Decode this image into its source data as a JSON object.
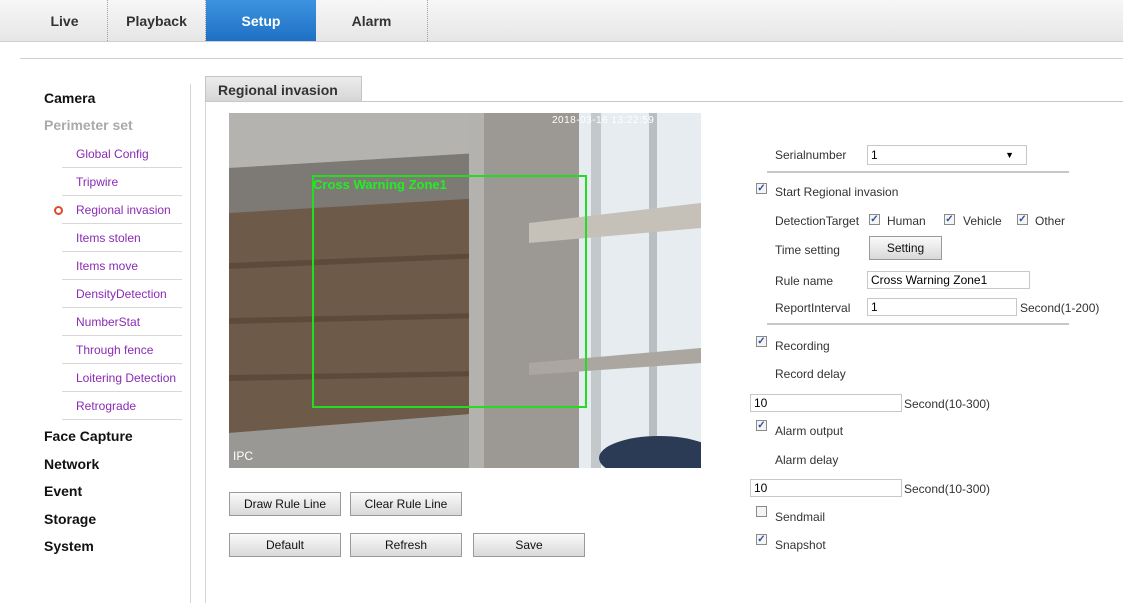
{
  "nav": {
    "tabs": [
      {
        "label": "Live"
      },
      {
        "label": "Playback"
      },
      {
        "label": "Setup"
      },
      {
        "label": "Alarm"
      }
    ]
  },
  "sidebar": {
    "camera": "Camera",
    "perimeter": "Perimeter set",
    "items": [
      {
        "label": "Global Config"
      },
      {
        "label": "Tripwire"
      },
      {
        "label": "Regional invasion"
      },
      {
        "label": "Items stolen"
      },
      {
        "label": "Items move"
      },
      {
        "label": "DensityDetection"
      },
      {
        "label": "NumberStat"
      },
      {
        "label": "Through fence"
      },
      {
        "label": "Loitering Detection"
      },
      {
        "label": "Retrograde"
      }
    ],
    "face_capture": "Face Capture",
    "network": "Network",
    "event": "Event",
    "storage": "Storage",
    "system": "System"
  },
  "section": {
    "title": "Regional invasion"
  },
  "video": {
    "zone_label": "Cross Warning Zone1",
    "osd_ipc": "IPC",
    "osd_time": "2018-03-16 13:22:59"
  },
  "buttons": {
    "draw": "Draw Rule Line",
    "clear": "Clear Rule Line",
    "default": "Default",
    "refresh": "Refresh",
    "save": "Save",
    "setting": "Setting"
  },
  "form": {
    "serial_label": "Serialnumber",
    "serial_value": "1",
    "start_label": "Start Regional invasion",
    "detection_label": "DetectionTarget",
    "human": "Human",
    "vehicle": "Vehicle",
    "other": "Other",
    "time_label": "Time setting",
    "rule_label": "Rule name",
    "rule_value": "Cross Warning Zone1",
    "report_label": "ReportInterval",
    "report_value": "1",
    "report_unit": "Second(1-200)",
    "recording": "Recording",
    "record_delay": "Record delay",
    "record_delay_value": "10",
    "record_unit": "Second(10-300)",
    "alarm_output": "Alarm output",
    "alarm_delay": "Alarm delay",
    "alarm_delay_value": "10",
    "alarm_unit": "Second(10-300)",
    "sendmail": "Sendmail",
    "snapshot": "Snapshot"
  }
}
